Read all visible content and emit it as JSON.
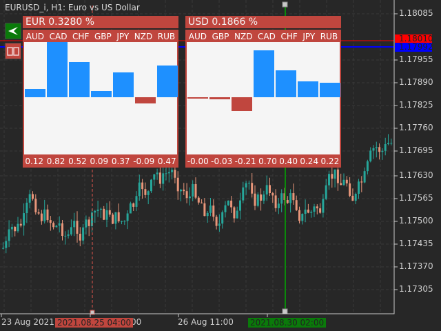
{
  "window": {
    "title": "EURUSD_i, H1:  Euro vs US Dollar"
  },
  "price_axis": {
    "labels": [
      "1.18085",
      "1.17955",
      "1.17890",
      "1.17825",
      "1.17760",
      "1.17695",
      "1.17630",
      "1.17565",
      "1.17500",
      "1.17435",
      "1.17370",
      "1.17305"
    ],
    "ask": "1.18010",
    "bid": "1.17992",
    "ask_color": "#ff0000",
    "bid_color": "#0000ff"
  },
  "time_axis": {
    "labels": [
      "23 Aug 2021",
      ":00",
      "26 Aug 11:00"
    ],
    "cursor_left": "2021.08.25 04:00",
    "cursor_right": "2021.08.30 02:00"
  },
  "colors": {
    "bull": "#26a69a",
    "bear": "#e8967a",
    "positive": "#1e90ff",
    "negative": "#c0463e"
  },
  "panels": [
    {
      "header": "EUR 0.3280 %",
      "currencies": [
        "AUD",
        "CAD",
        "CHF",
        "GBP",
        "JPY",
        "NZD",
        "RUB"
      ],
      "labels": [
        "0.12",
        "0.82",
        "0.52",
        "0.09",
        "0.37",
        "-0.09",
        "0.47"
      ],
      "values": [
        0.12,
        0.82,
        0.52,
        0.09,
        0.37,
        -0.09,
        0.47
      ]
    },
    {
      "header": "USD 0.1866 %",
      "currencies": [
        "AUD",
        "GBP",
        "NZD",
        "CAD",
        "CHF",
        "JPY",
        "RUB"
      ],
      "labels": [
        "-0.00",
        "-0.03",
        "-0.21",
        "0.70",
        "0.40",
        "0.24",
        "0.22"
      ],
      "values": [
        -0.0,
        -0.03,
        -0.21,
        0.7,
        0.4,
        0.24,
        0.22
      ]
    }
  ]
}
